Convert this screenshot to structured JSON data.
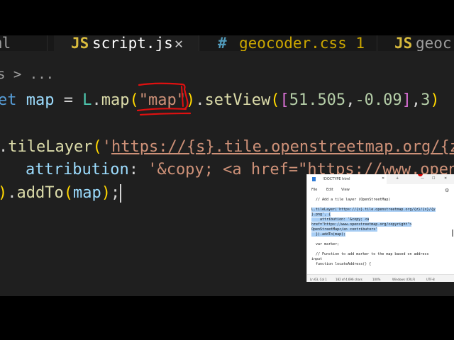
{
  "tabs": [
    {
      "icon": "html-file-icon",
      "label": "ml",
      "active": false
    },
    {
      "icon": "js-file-icon",
      "icon_glyph": "JS",
      "label": "script.js",
      "active": true,
      "close": "✕"
    },
    {
      "icon": "css-file-icon",
      "icon_glyph": "#",
      "label": "geocoder.css 1",
      "active": false
    },
    {
      "icon": "js-file-icon",
      "icon_glyph": "JS",
      "label": "geoc",
      "active": false
    }
  ],
  "breadcrumb": "s > ...",
  "code": {
    "line1": {
      "kw": "et",
      "var": "map",
      "eq": "=",
      "obj": "L",
      "dot1": ".",
      "fn": "map",
      "p_open": "(",
      "str": "\"map\"",
      "p_close": ")",
      "dot2": ".",
      "fn2": "setView",
      "p2_open": "(",
      "b_open": "[",
      "n1": "51.505",
      "c1": ",",
      "n2": "-0.09",
      "b_close": "]",
      "c2": ",",
      "n3": "3",
      "p2_close": ")"
    },
    "line2": {
      "dot": ".",
      "fn": "tileLayer",
      "p_open": "(",
      "q": "'",
      "url": "https://{s}.tile.openstreetmap.org/{z"
    },
    "line3": {
      "prop": "attribution",
      "colon": ":",
      "str": "'&copy; <a href=\"https://www.open"
    },
    "line4": {
      "p_close": ")",
      "dot": ".",
      "fn": "addTo",
      "p_open": "(",
      "var": "map",
      "p_close2": ")",
      "semi": ";"
    }
  },
  "notepad": {
    "tab_title": "!DOCTYPE html",
    "tab_close": "✕",
    "new_tab": "+",
    "window_controls": [
      "—",
      "☐",
      "✕"
    ],
    "menu": [
      "File",
      "Edit",
      "View"
    ],
    "settings_icon": "gear-icon",
    "lines": [
      {
        "text": "  // Add a tile layer (OpenStreetMap)",
        "selected": false
      },
      {
        "text": "",
        "selected": false
      },
      {
        "text": "L.tileLayer('https://{s}.tile.openstreetmap.org/{z}/{x}/{y",
        "selected": true
      },
      {
        "text": "}.png', {",
        "selected": true
      },
      {
        "text": "    attribution: '&copy; <a",
        "selected": true
      },
      {
        "text": "href=\"https://www.openstreetmap.org/copyright\">",
        "selected": true
      },
      {
        "text": "OpenStreetMap</a> contributors'",
        "selected": true
      },
      {
        "text": "  }).addTo(map);",
        "selected": true
      },
      {
        "text": "",
        "selected": false
      },
      {
        "text": "  var marker;",
        "selected": false
      },
      {
        "text": "",
        "selected": false
      },
      {
        "text": "  // Function to add marker to the map based on address",
        "selected": false
      },
      {
        "text": "input",
        "selected": false
      },
      {
        "text": "  function locateAddress() {",
        "selected": false
      }
    ],
    "status": {
      "position": "Ln 63, Col 1",
      "chars": "182 of 4,696 chars",
      "zoom": "100%",
      "eol": "Windows (CRLF)",
      "encoding": "UTF-8"
    }
  },
  "colors": {
    "editor_bg": "#1f1f1f",
    "annotation_red": "#e01010"
  }
}
